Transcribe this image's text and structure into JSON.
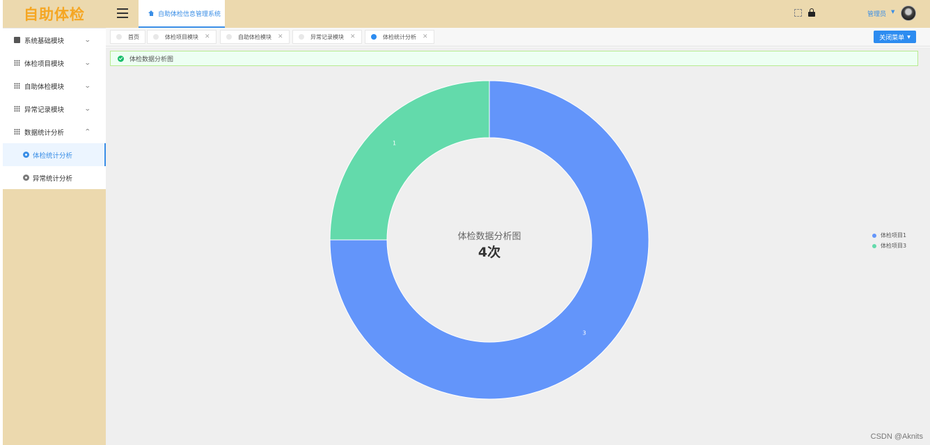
{
  "app": {
    "logo": "自助体检"
  },
  "sidebar": {
    "items": [
      {
        "label": "系统基础模块",
        "icon": "dashboard-icon",
        "expanded": false
      },
      {
        "label": "体检项目模块",
        "icon": "grid-icon",
        "expanded": false
      },
      {
        "label": "自助体检模块",
        "icon": "grid-icon",
        "expanded": false
      },
      {
        "label": "异常记录模块",
        "icon": "grid-icon",
        "expanded": false
      },
      {
        "label": "数据统计分析",
        "icon": "grid-icon",
        "expanded": true
      }
    ],
    "subitems": [
      {
        "label": "体检统计分析",
        "active": true
      },
      {
        "label": "异常统计分析",
        "active": false
      }
    ]
  },
  "header": {
    "home_tab": "自助体检信息管理系统",
    "user": "管理员"
  },
  "tags": [
    {
      "label": "首页",
      "closable": false,
      "active": false
    },
    {
      "label": "体检项目模块",
      "closable": true,
      "active": false
    },
    {
      "label": "自助体检模块",
      "closable": true,
      "active": false
    },
    {
      "label": "异常记录模块",
      "closable": true,
      "active": false
    },
    {
      "label": "体检统计分析",
      "closable": true,
      "active": true
    }
  ],
  "close_menu_label": "关闭菜单",
  "alert": {
    "text": "体检数据分析图"
  },
  "chart_data": {
    "type": "pie",
    "donut": true,
    "title": "体检数据分析图",
    "center_label": "4次",
    "legend_position": "right",
    "slices": [
      {
        "name": "体检项目1",
        "value": 3,
        "color": "#6395fa"
      },
      {
        "name": "体检项目3",
        "value": 1,
        "color": "#63daab"
      }
    ]
  },
  "watermark": "CSDN @Aknits",
  "colors": {
    "sidebar_bg": "#ecd9ae",
    "accent": "#3a8ee6",
    "primary_button": "#2d8cf0"
  }
}
